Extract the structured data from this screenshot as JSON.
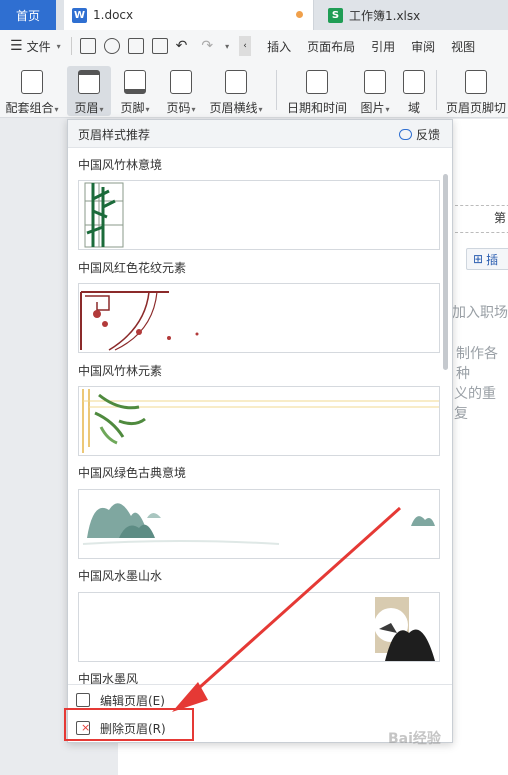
{
  "tabs": {
    "home": "首页",
    "doc": "1.docx",
    "sheet": "工作簿1.xlsx"
  },
  "menu": {
    "file": "文件",
    "items": [
      "插入",
      "页面布局",
      "引用",
      "审阅",
      "视图"
    ]
  },
  "ribbon": {
    "buttons": [
      "配套组合",
      "页眉",
      "页脚",
      "页码",
      "页眉横线",
      "日期和时间",
      "图片",
      "域",
      "页眉页脚切"
    ]
  },
  "panel": {
    "title": "页眉样式推荐",
    "feedback": "反馈",
    "styles": [
      "中国风竹林意境",
      "中国风红色花纹元素",
      "中国风竹林元素",
      "中国风绿色古典意境",
      "中国风水墨山水",
      "中国水墨风"
    ],
    "edit_header": "编辑页眉(E)",
    "delete_header": "删除页眉(R)"
  },
  "document": {
    "header_char": "第",
    "insert_btn": "插",
    "line1": "加入职场",
    "line2": "制作各种",
    "line3": "义的重复"
  },
  "watermark": "Bai经验",
  "colors": {
    "accent_blue": "#2f6fd1",
    "highlight_red": "#e53935",
    "word_icon": "#2f6fd1",
    "excel_icon": "#1f9d55"
  }
}
